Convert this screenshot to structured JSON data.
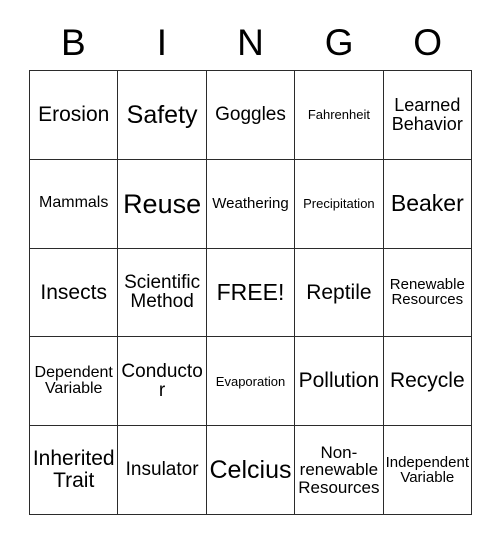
{
  "card": {
    "title": "Bingo Card",
    "header_letters": [
      "B",
      "I",
      "N",
      "G",
      "O"
    ],
    "grid_size": "5x5",
    "free_space_label": "FREE!",
    "colors": {
      "background": "#ffffff",
      "grid_line": "#2b2b2b",
      "text": "#000000"
    },
    "rows": [
      [
        {
          "label": "Erosion",
          "size": 21,
          "lines": 1
        },
        {
          "label": "Safety",
          "size": 25,
          "lines": 1
        },
        {
          "label": "Goggles",
          "size": 19,
          "lines": 1
        },
        {
          "label": "Fahrenheit",
          "size": 13,
          "lines": 1
        },
        {
          "label": "Learned Behavior",
          "size": 18,
          "lines": 2
        }
      ],
      [
        {
          "label": "Mammals",
          "size": 16,
          "lines": 1
        },
        {
          "label": "Reuse",
          "size": 27,
          "lines": 1
        },
        {
          "label": "Weathering",
          "size": 15,
          "lines": 1
        },
        {
          "label": "Precipitation",
          "size": 13,
          "lines": 1
        },
        {
          "label": "Beaker",
          "size": 23,
          "lines": 1
        }
      ],
      [
        {
          "label": "Insects",
          "size": 21,
          "lines": 1
        },
        {
          "label": "Scientific Method",
          "size": 19,
          "lines": 2
        },
        {
          "label": "FREE!",
          "size": 23,
          "lines": 1
        },
        {
          "label": "Reptile",
          "size": 21,
          "lines": 1
        },
        {
          "label": "Renewable Resources",
          "size": 15,
          "lines": 2
        }
      ],
      [
        {
          "label": "Dependent Variable",
          "size": 16,
          "lines": 2
        },
        {
          "label": "Conductor",
          "size": 19,
          "lines": 1
        },
        {
          "label": "Evaporation",
          "size": 13,
          "lines": 1
        },
        {
          "label": "Pollution",
          "size": 21,
          "lines": 1
        },
        {
          "label": "Recycle",
          "size": 21,
          "lines": 1
        }
      ],
      [
        {
          "label": "Inherited Trait",
          "size": 21,
          "lines": 2
        },
        {
          "label": "Insulator",
          "size": 19,
          "lines": 1
        },
        {
          "label": "Celcius",
          "size": 25,
          "lines": 1
        },
        {
          "label": "Non-renewable Resources",
          "size": 17,
          "lines": 3
        },
        {
          "label": "Independent Variable",
          "size": 15,
          "lines": 2
        }
      ]
    ]
  }
}
